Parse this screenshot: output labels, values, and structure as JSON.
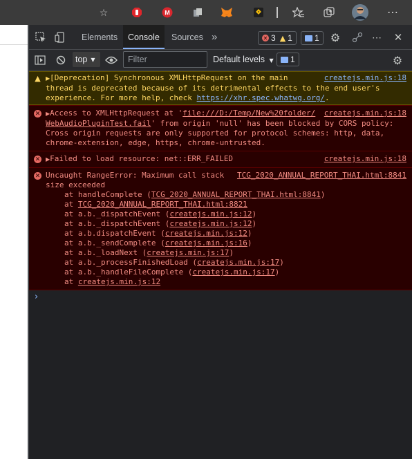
{
  "browser": {
    "extensions": [
      {
        "name": "add-favorite-icon",
        "glyph": "☆"
      },
      {
        "name": "adblock-extension-icon",
        "glyph": "✋",
        "color": "#e0262b"
      },
      {
        "name": "mega-extension-icon",
        "glyph": "M",
        "color": "#d9272e"
      },
      {
        "name": "collections-extension-icon",
        "glyph": "▥",
        "color": "#9aa0a6"
      },
      {
        "name": "metamask-extension-icon",
        "glyph": "🦊",
        "color": "#f6851b"
      },
      {
        "name": "binance-extension-icon",
        "glyph": "◆",
        "color": "#f0b90b"
      }
    ],
    "right_icons": [
      "favorites-icon",
      "collections-icon",
      "profile-avatar",
      "more-icon"
    ]
  },
  "devtools": {
    "tabs": [
      {
        "label": "Elements",
        "active": false
      },
      {
        "label": "Console",
        "active": true
      },
      {
        "label": "Sources",
        "active": false
      }
    ],
    "more_tabs_label": "»",
    "error_count": "3",
    "warning_count": "1",
    "message_count": "1",
    "close_label": "✕"
  },
  "toolbar": {
    "context": "top",
    "filter_placeholder": "Filter",
    "levels_label": "Default levels",
    "issues_count": "1"
  },
  "messages": [
    {
      "type": "warning",
      "text_prefix": "[Deprecation] Synchronous XMLHttpRequest on the main thread is deprecated because of its detrimental effects to the end user's experience. For more help, check ",
      "link": "https://xhr.spec.whatwg.org/",
      "text_suffix": ".",
      "source": "createjs.min.js:18"
    },
    {
      "type": "error",
      "text_prefix": "Access to XMLHttpRequest at '",
      "link": "file:///D:/Temp/New%20folder/WebAudioPluginTest.fail",
      "text_suffix": "' from origin 'null' has been blocked by CORS policy: Cross origin requests are only supported for protocol schemes: http, data, chrome-extension, edge, https, chrome-untrusted.",
      "source": "createjs.min.js:18"
    },
    {
      "type": "error",
      "text": "Failed to load resource: net::ERR_FAILED",
      "source": "createjs.min.js:18"
    },
    {
      "type": "error",
      "text": "Uncaught RangeError: Maximum call stack size exceeded",
      "source": "TCG_2020_ANNUAL_REPORT_THAI.html:8841",
      "stack": [
        {
          "fn": "at handleComplete (",
          "loc": "TCG_2020_ANNUAL_REPORT_THAI.html:8841",
          "end": ")"
        },
        {
          "fn": "at ",
          "loc": "TCG_2020_ANNUAL_REPORT_THAI.html:8821",
          "end": ""
        },
        {
          "fn": "at a.b._dispatchEvent (",
          "loc": "createjs.min.js:12",
          "end": ")"
        },
        {
          "fn": "at a.b._dispatchEvent (",
          "loc": "createjs.min.js:12",
          "end": ")"
        },
        {
          "fn": "at a.b.dispatchEvent (",
          "loc": "createjs.min.js:12",
          "end": ")"
        },
        {
          "fn": "at a.b._sendComplete (",
          "loc": "createjs.min.js:16",
          "end": ")"
        },
        {
          "fn": "at a.b._loadNext (",
          "loc": "createjs.min.js:17",
          "end": ")"
        },
        {
          "fn": "at a.b._processFinishedLoad (",
          "loc": "createjs.min.js:17",
          "end": ")"
        },
        {
          "fn": "at a.b._handleFileComplete (",
          "loc": "createjs.min.js:17",
          "end": ")"
        },
        {
          "fn": "at ",
          "loc": "createjs.min.js:12",
          "end": ""
        }
      ]
    }
  ],
  "prompt_symbol": "›"
}
